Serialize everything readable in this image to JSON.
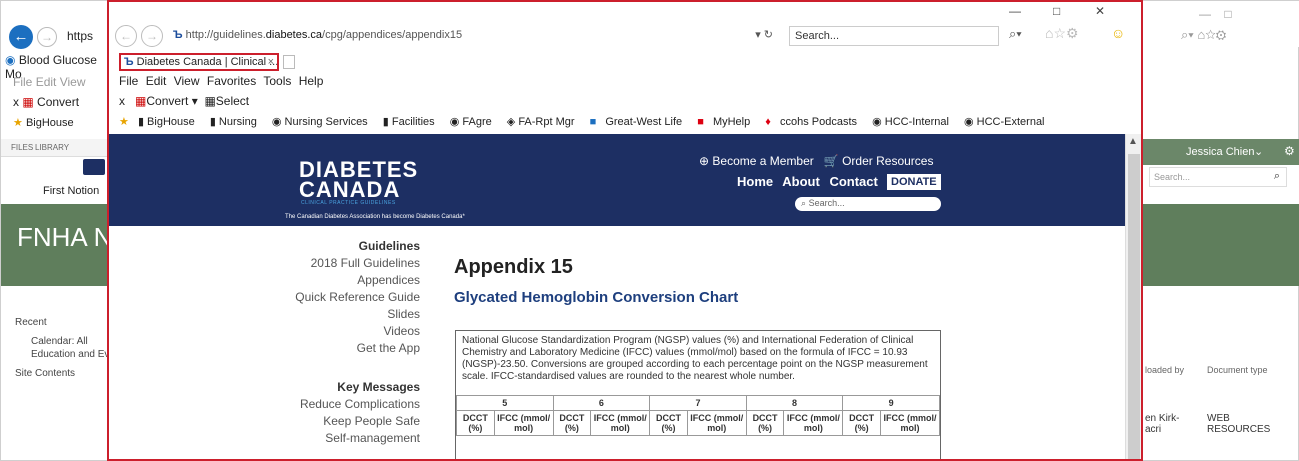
{
  "background": {
    "url_fragment": "https",
    "tab_label": "Blood Glucose Mo",
    "menu": [
      "File",
      "Edit",
      "View"
    ],
    "convert_label": "Convert",
    "fav_label": "BigHouse",
    "sharepoint_tabs": [
      "FILES",
      "LIBRARY"
    ],
    "logo_text": "First Notion",
    "page_title": "FNHA Nu",
    "user_name": "Jessica Chien",
    "search_placeholder": "Search...",
    "left_nav": [
      "Recent",
      "Calendar: All",
      "Education and Eve",
      "Site Contents"
    ],
    "columns": [
      "loaded by",
      "Document type"
    ],
    "row_author": "en Kirk-\nacri",
    "row_type": "WEB\nRESOURCES"
  },
  "browser": {
    "url_prefix": "http://guidelines.",
    "url_domain": "diabetes.ca",
    "url_suffix": "/cpg/appendices/appendix15",
    "search_placeholder": "Search...",
    "tab_title": "Diabetes Canada | Clinical ...",
    "menu": [
      "File",
      "Edit",
      "View",
      "Favorites",
      "Tools",
      "Help"
    ],
    "convert_label": "Convert",
    "select_label": "Select",
    "favorites": [
      "BigHouse",
      "Nursing",
      "Nursing Services",
      "Facilities",
      "FAgre",
      "FA-Rpt Mgr",
      "Great-West Life",
      "MyHelp",
      "ccohs Podcasts",
      "HCC-Internal",
      "HCC-External"
    ]
  },
  "site": {
    "logo_line1": "DIABETES",
    "logo_line2": "CANADA",
    "logo_tagline": "CLINICAL PRACTICE GUIDELINES",
    "logo_note": "The Canadian Diabetes Association has become Diabetes Canada*",
    "become_member": "Become a Member",
    "order_resources": "Order Resources",
    "nav": [
      "Home",
      "About",
      "Contact"
    ],
    "donate": "DONATE",
    "search_placeholder": "Search...",
    "left_nav_heading1": "Guidelines",
    "left_nav_items1": [
      "2018 Full Guidelines",
      "Appendices",
      "Quick Reference Guide",
      "Slides",
      "Videos",
      "Get the App"
    ],
    "left_nav_heading2": "Key Messages",
    "left_nav_items2": [
      "Reduce Complications",
      "Keep People Safe",
      "Self-management"
    ],
    "heading": "Appendix 15",
    "subheading": "Glycated Hemoglobin Conversion Chart",
    "description": "National Glucose Standardization Program (NGSP) values (%) and International Federation of Clinical Chemistry and Laboratory Medicine (IFCC) values (mmol/mol) based on the formula of IFCC = 10.93 (NGSP)-23.50. Conversions are grouped according to each percentage point on the NGSP measurement scale. IFCC-standardised values are rounded to the nearest whole number.",
    "table_groups": [
      "5",
      "6",
      "7",
      "8",
      "9"
    ],
    "col_dcct": "DCCT (%)",
    "col_ifcc": "IFCC (mmol/ mol)"
  }
}
